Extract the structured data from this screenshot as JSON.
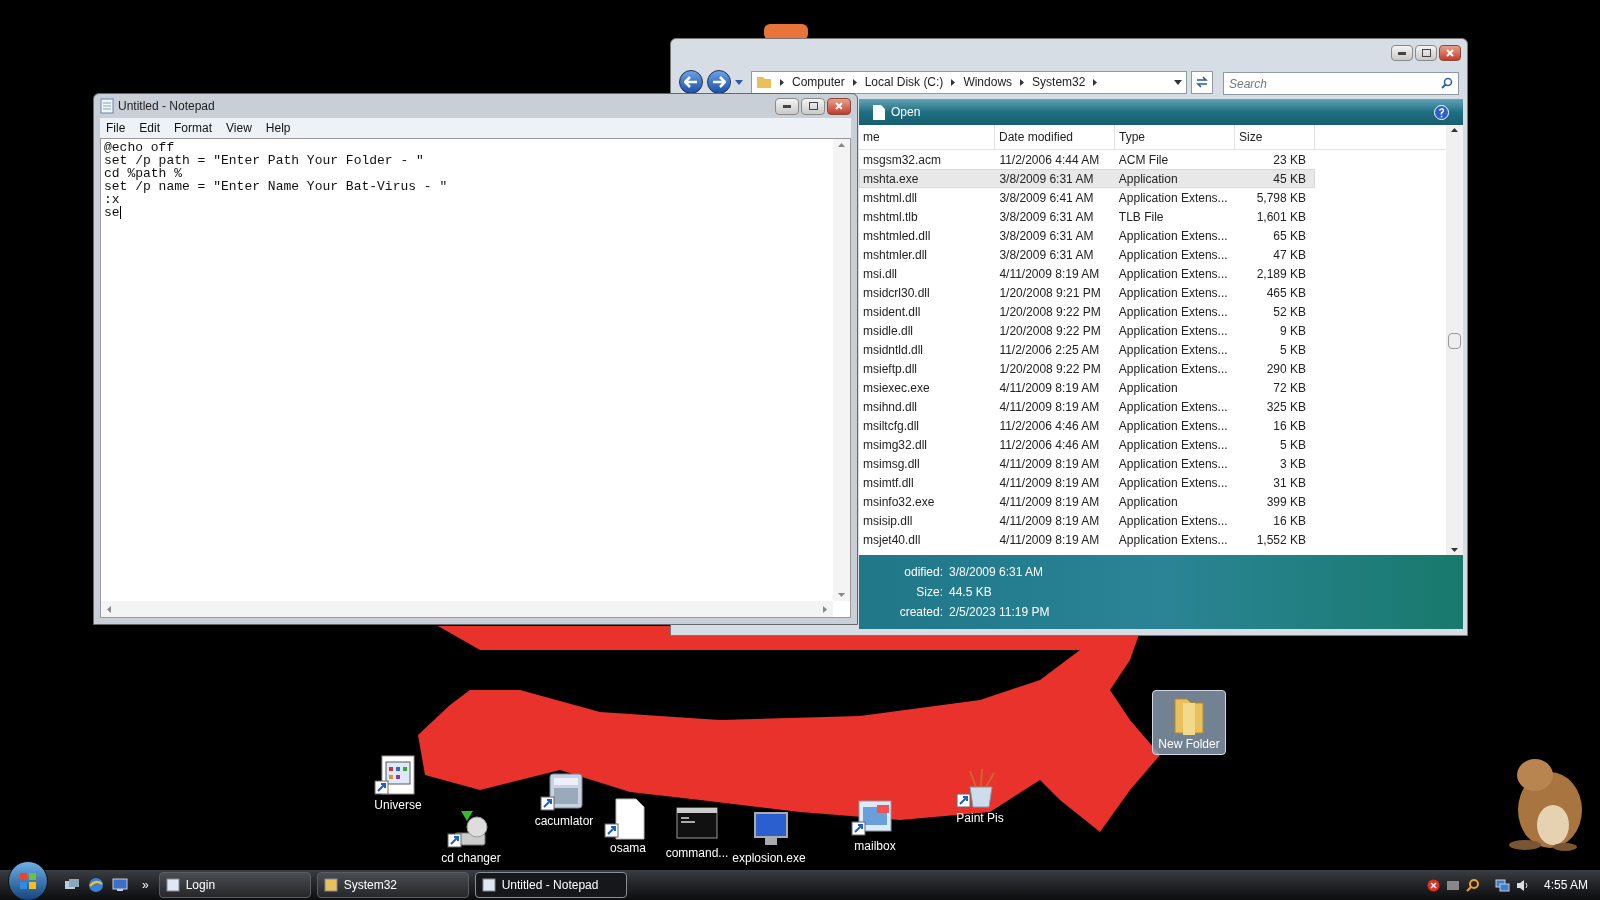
{
  "notepad": {
    "title": "Untitled - Notepad",
    "menu": [
      "File",
      "Edit",
      "Format",
      "View",
      "Help"
    ],
    "lines": [
      "@echo off",
      "set /p path = \"Enter Path Your Folder - \"",
      "cd %path %",
      "set /p name = \"Enter Name Your Bat-Virus - \"",
      ":x",
      "se"
    ]
  },
  "explorer": {
    "breadcrumb": [
      "Computer",
      "Local Disk (C:)",
      "Windows",
      "System32"
    ],
    "search": {
      "placeholder": "Search"
    },
    "toolbar": {
      "open": "Open"
    },
    "columns": [
      "me",
      "Date modified",
      "Type",
      "Size"
    ],
    "rows": [
      {
        "name": "msgsm32.acm",
        "date": "11/2/2006 4:44 AM",
        "type": "ACM File",
        "size": "23 KB",
        "selected": false
      },
      {
        "name": "mshta.exe",
        "date": "3/8/2009 6:31 AM",
        "type": "Application",
        "size": "45 KB",
        "selected": true
      },
      {
        "name": "mshtml.dll",
        "date": "3/8/2009 6:41 AM",
        "type": "Application Extens...",
        "size": "5,798 KB",
        "selected": false
      },
      {
        "name": "mshtml.tlb",
        "date": "3/8/2009 6:31 AM",
        "type": "TLB File",
        "size": "1,601 KB",
        "selected": false
      },
      {
        "name": "mshtmled.dll",
        "date": "3/8/2009 6:31 AM",
        "type": "Application Extens...",
        "size": "65 KB",
        "selected": false
      },
      {
        "name": "mshtmler.dll",
        "date": "3/8/2009 6:31 AM",
        "type": "Application Extens...",
        "size": "47 KB",
        "selected": false
      },
      {
        "name": "msi.dll",
        "date": "4/11/2009 8:19 AM",
        "type": "Application Extens...",
        "size": "2,189 KB",
        "selected": false
      },
      {
        "name": "msidcrl30.dll",
        "date": "1/20/2008 9:21 PM",
        "type": "Application Extens...",
        "size": "465 KB",
        "selected": false
      },
      {
        "name": "msident.dll",
        "date": "1/20/2008 9:22 PM",
        "type": "Application Extens...",
        "size": "52 KB",
        "selected": false
      },
      {
        "name": "msidle.dll",
        "date": "1/20/2008 9:22 PM",
        "type": "Application Extens...",
        "size": "9 KB",
        "selected": false
      },
      {
        "name": "msidntld.dll",
        "date": "11/2/2006 2:25 AM",
        "type": "Application Extens...",
        "size": "5 KB",
        "selected": false
      },
      {
        "name": "msieftp.dll",
        "date": "1/20/2008 9:22 PM",
        "type": "Application Extens...",
        "size": "290 KB",
        "selected": false
      },
      {
        "name": "msiexec.exe",
        "date": "4/11/2009 8:19 AM",
        "type": "Application",
        "size": "72 KB",
        "selected": false
      },
      {
        "name": "msihnd.dll",
        "date": "4/11/2009 8:19 AM",
        "type": "Application Extens...",
        "size": "325 KB",
        "selected": false
      },
      {
        "name": "msiltcfg.dll",
        "date": "11/2/2006 4:46 AM",
        "type": "Application Extens...",
        "size": "16 KB",
        "selected": false
      },
      {
        "name": "msimg32.dll",
        "date": "11/2/2006 4:46 AM",
        "type": "Application Extens...",
        "size": "5 KB",
        "selected": false
      },
      {
        "name": "msimsg.dll",
        "date": "4/11/2009 8:19 AM",
        "type": "Application Extens...",
        "size": "3 KB",
        "selected": false
      },
      {
        "name": "msimtf.dll",
        "date": "4/11/2009 8:19 AM",
        "type": "Application Extens...",
        "size": "31 KB",
        "selected": false
      },
      {
        "name": "msinfo32.exe",
        "date": "4/11/2009 8:19 AM",
        "type": "Application",
        "size": "399 KB",
        "selected": false
      },
      {
        "name": "msisip.dll",
        "date": "4/11/2009 8:19 AM",
        "type": "Application Extens...",
        "size": "16 KB",
        "selected": false
      },
      {
        "name": "msjet40.dll",
        "date": "4/11/2009 8:19 AM",
        "type": "Application Extens...",
        "size": "1,552 KB",
        "selected": false
      }
    ],
    "details": [
      {
        "label": "odified:",
        "value": "3/8/2009 6:31 AM"
      },
      {
        "label": "Size:",
        "value": "44.5 KB"
      },
      {
        "label": "created:",
        "value": "2/5/2023 11:19 PM"
      }
    ]
  },
  "desktop_icons": [
    {
      "label": "Universe",
      "kind": "program",
      "shortcut": true,
      "selected": false
    },
    {
      "label": "cd changer",
      "kind": "disc",
      "shortcut": true,
      "selected": false
    },
    {
      "label": "cacumlator",
      "kind": "calculator",
      "shortcut": true,
      "selected": false
    },
    {
      "label": "osama",
      "kind": "document",
      "shortcut": true,
      "selected": false
    },
    {
      "label": "command...",
      "kind": "console",
      "shortcut": false,
      "selected": false
    },
    {
      "label": "explosion.exe",
      "kind": "monitor",
      "shortcut": false,
      "selected": false
    },
    {
      "label": "mailbox",
      "kind": "mail",
      "shortcut": true,
      "selected": false
    },
    {
      "label": "Paint Pis",
      "kind": "paint",
      "shortcut": true,
      "selected": false
    },
    {
      "label": "New Folder",
      "kind": "folder",
      "shortcut": false,
      "selected": true
    }
  ],
  "taskbar": {
    "buttons": [
      {
        "label": "Login",
        "selected": false
      },
      {
        "label": "System32",
        "selected": false
      },
      {
        "label": "Untitled - Notepad",
        "selected": true
      }
    ],
    "overflow": "»",
    "clock": "4:55 AM"
  }
}
